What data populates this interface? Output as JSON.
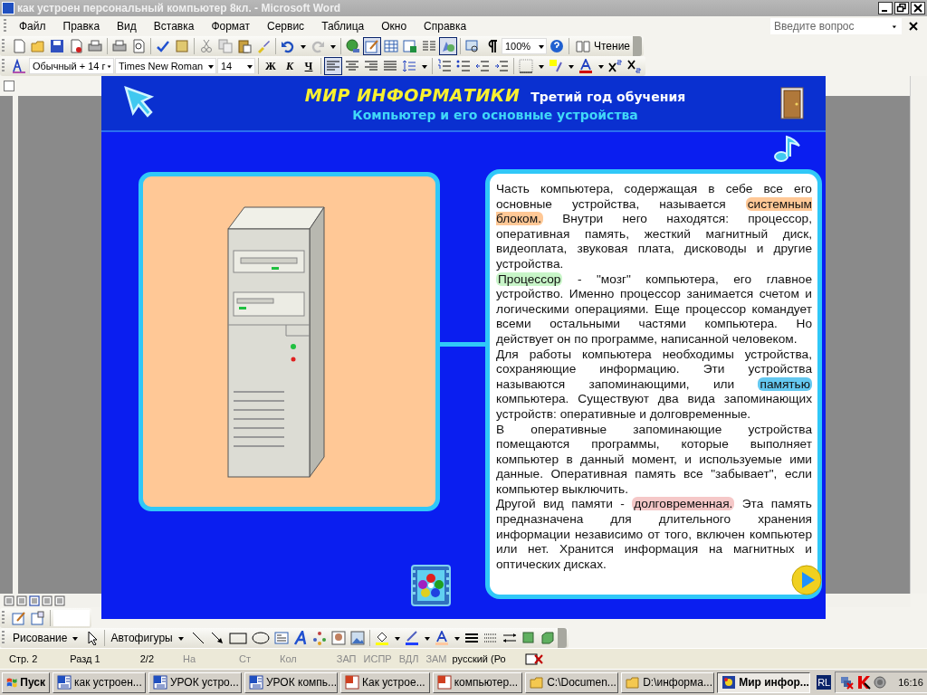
{
  "window": {
    "title": "как устроен персональный компьютер 8кл. - Microsoft Word"
  },
  "menu": [
    "Файл",
    "Правка",
    "Вид",
    "Вставка",
    "Формат",
    "Сервис",
    "Таблица",
    "Окно",
    "Справка"
  ],
  "help_field": {
    "placeholder": "Введите вопрос"
  },
  "standard_toolbar": {
    "zoom": "100%",
    "reading_button": "Чтение"
  },
  "formatting_toolbar": {
    "style": "Обычный + 14 г",
    "font": "Times New Roman",
    "size": "14",
    "bold": "Ж",
    "italic": "К",
    "underline": "Ч",
    "alignments": [
      {
        "selected": true
      },
      {
        "selected": false
      },
      {
        "selected": false
      },
      {
        "selected": false
      }
    ]
  },
  "slide": {
    "title": "МИР ИНФОРМАТИКИ",
    "subtitle": "Третий год обучения",
    "topic": "Компьютер и его основные устройства",
    "paragraphs": [
      {
        "segments": [
          {
            "text": "Часть компьютера, содержащая в себе все его основные устройства, называется "
          },
          {
            "text": "системным блоком.",
            "color": "#ffc896"
          },
          {
            "text": " Внутри него находятся: процессор, оперативная память, жесткий магнитный диск, видеоплата, звуковая плата, дисководы и другие устройства."
          }
        ]
      },
      {
        "segments": [
          {
            "text": "Процессор",
            "color": "#c8f5c8"
          },
          {
            "text": " - \"мозг\" компьютера, его главное устройство. Именно процессор занимается счетом и логическими операциями. Еще процессор командует всеми остальными частями компьютера. Но действует он по программе, написанной человеком."
          }
        ]
      },
      {
        "segments": [
          {
            "text": "Для работы компьютера необходимы устройства, сохраняющие информацию. Эти устройства называются запоминающими, или "
          },
          {
            "text": "памятью",
            "color": "#64c8f0"
          },
          {
            "text": " компьютера. Существуют два вида запоминающих устройств: оперативные и долговременные."
          }
        ]
      },
      {
        "segments": [
          {
            "text": "В оперативные запоминающие устройства помещаются программы, которые выполняет компьютер в данный момент, и используемые ими данные. Оперативная память все \"забывает\", если компьютер выключить."
          }
        ]
      },
      {
        "segments": [
          {
            "text": "Другой вид памяти - "
          },
          {
            "text": "долговременная.",
            "color": "#f5c8c8"
          },
          {
            "text": " Эта память предназначена для длительного хранения информации независимо от того, включен компьютер или нет. Хранится информация на магнитных и оптических дисках."
          }
        ]
      }
    ]
  },
  "drawing_toolbar": {
    "drawing_menu": "Рисование",
    "autoshapes_menu": "Автофигуры"
  },
  "status_bar": [
    {
      "text": "Стр. 2",
      "disabled": false
    },
    {
      "text": "Разд 1",
      "disabled": false
    },
    {
      "text": "2/2",
      "disabled": false
    },
    {
      "text": "На",
      "disabled": true
    },
    {
      "text": "Ст",
      "disabled": true
    },
    {
      "text": "Кол",
      "disabled": true
    },
    {
      "text": "ЗАП",
      "disabled": true
    },
    {
      "text": "ИСПР",
      "disabled": true
    },
    {
      "text": "ВДЛ",
      "disabled": true
    },
    {
      "text": "ЗАМ",
      "disabled": true
    },
    {
      "text": "русский (Ро",
      "disabled": false
    }
  ],
  "taskbar": {
    "start": "Пуск",
    "tasks": [
      {
        "label": "как устроен...",
        "kind": "word",
        "selected": false
      },
      {
        "label": "УРОК устро...",
        "kind": "word",
        "selected": false
      },
      {
        "label": "УРОК компь...",
        "kind": "word",
        "selected": false
      },
      {
        "label": "Как устрое...",
        "kind": "presentation",
        "selected": false
      },
      {
        "label": "компьютер...",
        "kind": "presentation",
        "selected": false
      },
      {
        "label": "C:\\Documen...",
        "kind": "folder",
        "selected": false
      },
      {
        "label": "D:\\информа...",
        "kind": "folder",
        "selected": false
      },
      {
        "label": "Мир инфор...",
        "kind": "app",
        "selected": true
      }
    ],
    "language": "RL",
    "time": "16:16"
  }
}
